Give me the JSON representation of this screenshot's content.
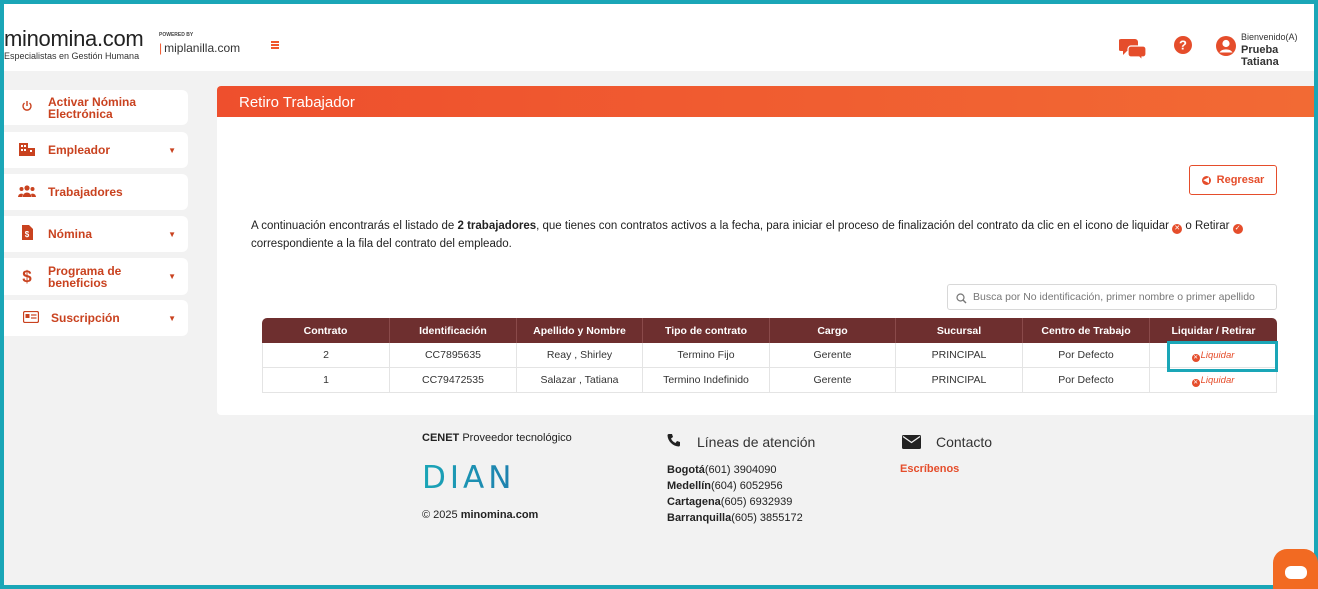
{
  "header": {
    "logo": "minomina.com",
    "logo_tagline": "Especialistas en Gestión Humana",
    "powered_by": "POWERED BY",
    "partner": "miplanilla.com",
    "welcome": "Bienvenido(A)",
    "user_name": "Prueba Tatiana"
  },
  "sidebar": {
    "items": [
      {
        "label": "Activar Nómina Electrónica",
        "icon": "power-icon"
      },
      {
        "label": "Empleador",
        "icon": "building-icon"
      },
      {
        "label": "Trabajadores",
        "icon": "users-icon"
      },
      {
        "label": "Nómina",
        "icon": "dollar-document-icon"
      },
      {
        "label": "Programa de beneficios",
        "icon": "dollar-icon"
      },
      {
        "label": "Suscripción",
        "icon": "id-card-icon"
      }
    ]
  },
  "main": {
    "title": "Retiro Trabajador",
    "back_button": "Regresar",
    "intro_part1": "A continuación encontrarás el listado de ",
    "intro_bold": "2 trabajadores",
    "intro_part2": ", que tienes con contratos activos a la fecha, para iniciar el proceso de finalización del contrato da clic en el icono de liquidar ",
    "intro_part3": " o Retirar ",
    "intro_part4": "correspondiente a la fila del contrato del empleado.",
    "search_placeholder": "Busca por No identificación, primer nombre o primer apellido",
    "table": {
      "headers": [
        "Contrato",
        "Identificación",
        "Apellido y Nombre",
        "Tipo de contrato",
        "Cargo",
        "Sucursal",
        "Centro de Trabajo",
        "Liquidar / Retirar"
      ],
      "rows": [
        {
          "contrato": "2",
          "identificacion": "CC7895635",
          "nombre": "Reay , Shirley",
          "tipo": "Termino Fijo",
          "cargo": "Gerente",
          "sucursal": "PRINCIPAL",
          "centro": "Por Defecto",
          "accion": "Liquidar"
        },
        {
          "contrato": "1",
          "identificacion": "CC79472535",
          "nombre": "Salazar , Tatiana",
          "tipo": "Termino Indefinido",
          "cargo": "Gerente",
          "sucursal": "PRINCIPAL",
          "centro": "Por Defecto",
          "accion": "Liquidar"
        }
      ]
    }
  },
  "footer": {
    "cenet_bold": "CENET",
    "cenet_text": " Proveedor tecnológico",
    "dian": "DIAN",
    "copyright_prefix": "© 2025 ",
    "copyright_site": "minomina.com",
    "lineas_title": "Líneas de atención",
    "phones": [
      {
        "city": "Bogotá",
        "number": "(601) 3904090"
      },
      {
        "city": "Medellín",
        "number": "(604) 6052956"
      },
      {
        "city": "Cartagena",
        "number": "(605) 6932939"
      },
      {
        "city": "Barranquilla",
        "number": "(605) 3855172"
      }
    ],
    "contacto_title": "Contacto",
    "escribenos": "Escríbenos"
  },
  "colors": {
    "accent": "#e54d2b",
    "table_header": "#6e2f2f",
    "highlight": "#1aa6b7"
  }
}
